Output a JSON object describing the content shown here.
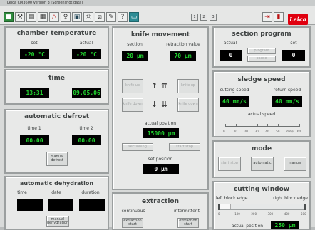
{
  "window": {
    "title": "Leica CM3600 Version 3 [Screenshot.data]"
  },
  "toolbar": {
    "icons": [
      "green-square-icon",
      "hammer-icon",
      "document-icon",
      "table-icon",
      "warning-triangle-icon",
      "bulb-icon",
      "save-icon",
      "printer-icon",
      "sledge-icon",
      "tools-icon",
      "help-icon",
      "teal-monitor-icon",
      "exit-door-icon",
      "book-icon"
    ],
    "mini": [
      "1",
      "2",
      "3"
    ],
    "brand": "Leica"
  },
  "chamber": {
    "title": "chamber temperature",
    "set_label": "set",
    "actual_label": "actual",
    "set_value": "-20 °C",
    "actual_value": "-20 °C"
  },
  "time": {
    "title": "time",
    "clock": "13:31",
    "date": "09.05.06"
  },
  "defrost": {
    "title": "automatic defrost",
    "time1_label": "time 1",
    "time2_label": "time 2",
    "time1": "00:00",
    "time2": "00:00",
    "button": "manual defrost"
  },
  "dehydration": {
    "title": "automatic dehydration",
    "time_label": "time",
    "date_label": "date",
    "duration_label": "duration",
    "button": "manual dehydration"
  },
  "knife": {
    "title": "knife movement",
    "section_label": "section",
    "retraction_label": "retraction value",
    "section_value": "20 µm",
    "retraction_value": "70 µm",
    "knife_up1": "knife up",
    "knife_up2": "knife up",
    "knife_down1": "knife down",
    "knife_down2": "knife down",
    "actual_position_label": "actual position",
    "actual_position": "15000 µm",
    "left_btn": "sectioning",
    "right_btn": "start stop",
    "set_position_label": "set position",
    "set_position": "0 µm"
  },
  "extraction": {
    "title": "extraction",
    "continuous_label": "continuous",
    "intermittent_label": "intermittent",
    "btn_left": "extraction start",
    "btn_right": "extraction start"
  },
  "section_program": {
    "title": "section program",
    "actual_label": "actual",
    "set_label": "set",
    "actual": "0",
    "set": "0",
    "btn1": "program",
    "btn2": "pause"
  },
  "sledge": {
    "title": "sledge speed",
    "cutting_label": "cutting speed",
    "return_label": "return speed",
    "cutting": "40 mm/s",
    "return": "40 mm/s",
    "actual_label": "actual speed",
    "scale_ticks": [
      "0",
      "10",
      "20",
      "30",
      "40",
      "50",
      "mm/s",
      "60"
    ],
    "actual_speed_mm_s": 0
  },
  "mode": {
    "title": "mode",
    "btn1": "start stop",
    "btn2": "automatic",
    "btn3": "manual"
  },
  "cutting_window": {
    "title": "cutting window",
    "left_label": "left block edge",
    "right_label": "right block edge",
    "ticks": [
      "0",
      "100",
      "200",
      "300",
      "400",
      "500"
    ],
    "left_fill": 0.14,
    "actual_label": "actual position",
    "actual": "250 µm"
  }
}
